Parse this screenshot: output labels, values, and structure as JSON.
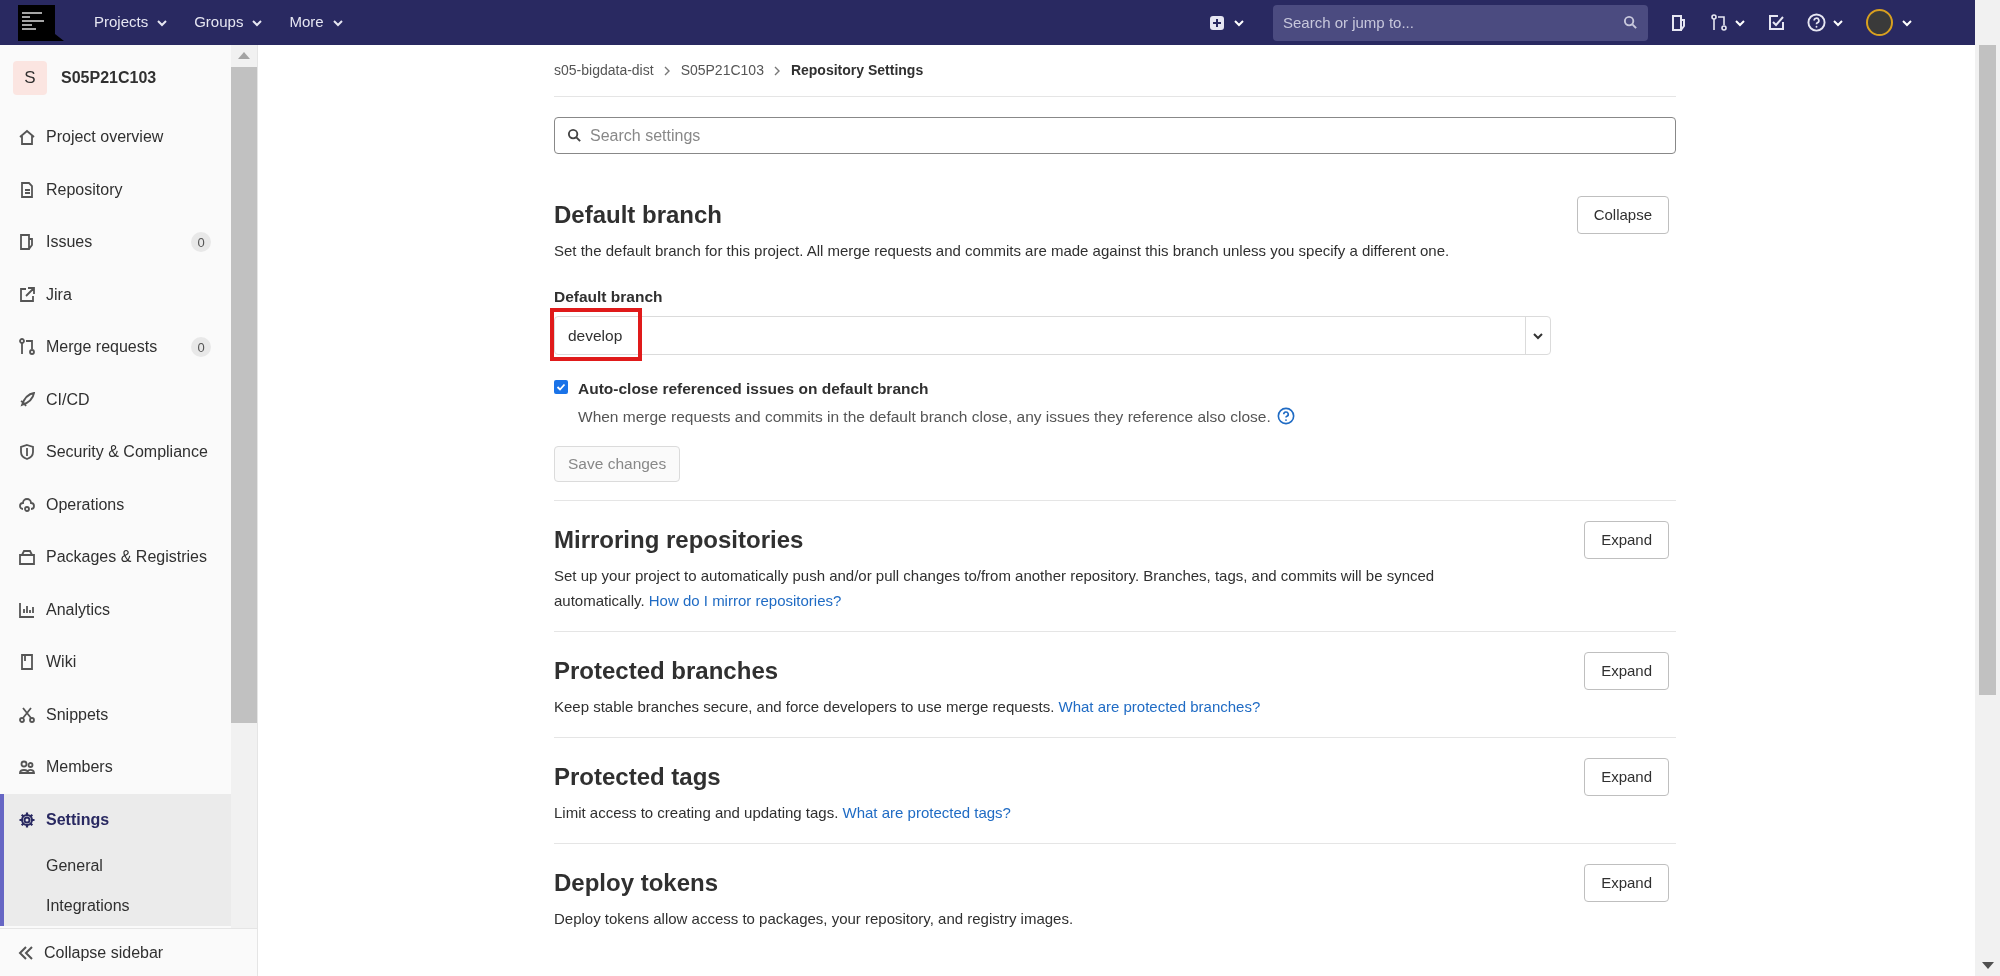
{
  "top_bar": {
    "menus": [
      "Projects",
      "Groups",
      "More"
    ],
    "search": {
      "placeholder": "Search or jump to..."
    }
  },
  "sidebar": {
    "project": {
      "avatar_letter": "S",
      "name": "S05P21C103"
    },
    "items": [
      {
        "label": "Project overview",
        "selected": false
      },
      {
        "label": "Repository",
        "selected": false
      },
      {
        "label": "Issues",
        "count": "0",
        "selected": false
      },
      {
        "label": "Jira",
        "selected": false
      },
      {
        "label": "Merge requests",
        "count": "0",
        "selected": false
      },
      {
        "label": "CI/CD",
        "selected": false
      },
      {
        "label": "Security & Compliance",
        "selected": false
      },
      {
        "label": "Operations",
        "selected": false
      },
      {
        "label": "Packages & Registries",
        "selected": false
      },
      {
        "label": "Analytics",
        "selected": false
      },
      {
        "label": "Wiki",
        "selected": false
      },
      {
        "label": "Snippets",
        "selected": false
      },
      {
        "label": "Members",
        "selected": false
      },
      {
        "label": "Settings",
        "selected": true,
        "children": [
          {
            "label": "General",
            "selected": false
          },
          {
            "label": "Integrations",
            "selected": false
          }
        ]
      }
    ],
    "collapse_label": "Collapse sidebar"
  },
  "breadcrumbs": [
    "s05-bigdata-dist",
    "S05P21C103",
    "Repository Settings"
  ],
  "search_settings": {
    "placeholder": "Search settings"
  },
  "sections": [
    {
      "title": "Default branch",
      "toggle": "Collapse",
      "description": "Set the default branch for this project. All merge requests and commits are made against this branch unless you specify a different one.",
      "form": {
        "label": "Default branch",
        "value": "develop",
        "highlighted": true,
        "checkbox": {
          "label": "Auto-close referenced issues on default branch",
          "checked": true,
          "help": "When merge requests and commits in the default branch close, any issues they reference also close."
        },
        "save": {
          "label": "Save changes",
          "disabled": true
        }
      }
    },
    {
      "title": "Mirroring repositories",
      "toggle": "Expand",
      "description": "Set up your project to automatically push and/or pull changes to/from another repository. Branches, tags, and commits will be synced automatically.",
      "link": "How do I mirror repositories?"
    },
    {
      "title": "Protected branches",
      "toggle": "Expand",
      "description": "Keep stable branches secure, and force developers to use merge requests.",
      "link": "What are protected branches?"
    },
    {
      "title": "Protected tags",
      "toggle": "Expand",
      "description": "Limit access to creating and updating tags.",
      "link": "What are protected tags?"
    },
    {
      "title": "Deploy tokens",
      "toggle": "Expand",
      "description": "Deploy tokens allow access to packages, your repository, and registry images."
    }
  ]
}
